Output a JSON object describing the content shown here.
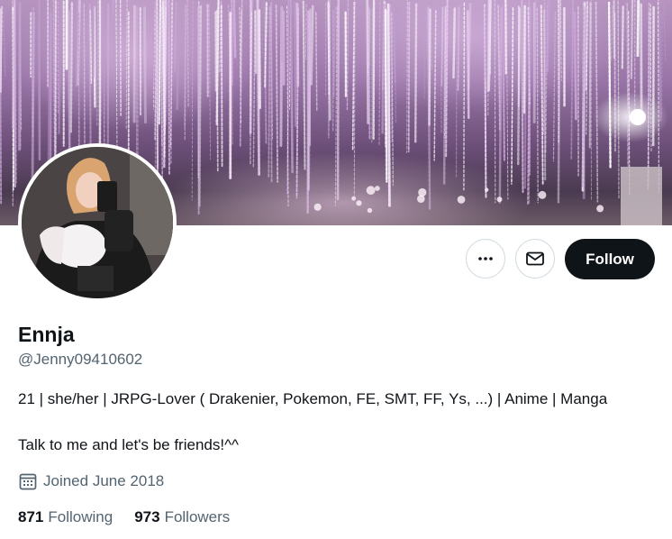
{
  "profile": {
    "display_name": "Ennja",
    "handle": "@Jenny09410602",
    "bio_line1": "21 | she/her | JRPG-Lover ( Drakenier, Pokemon, FE, SMT, FF, Ys, ...) | Anime | Manga",
    "bio_line2": "Talk to me and let's be friends!^^",
    "joined": "Joined June 2018",
    "following_count": "871",
    "following_label": "Following",
    "followers_count": "973",
    "followers_label": "Followers"
  },
  "actions": {
    "more_icon": "more-horizontal-icon",
    "message_icon": "envelope-icon",
    "follow_label": "Follow"
  },
  "icons": {
    "joined": "calendar-icon"
  },
  "colors": {
    "text_primary": "#0f1419",
    "text_secondary": "#536471",
    "border": "#cfd9de",
    "follow_bg": "#0f1419",
    "banner_tint": "#b795c0"
  }
}
